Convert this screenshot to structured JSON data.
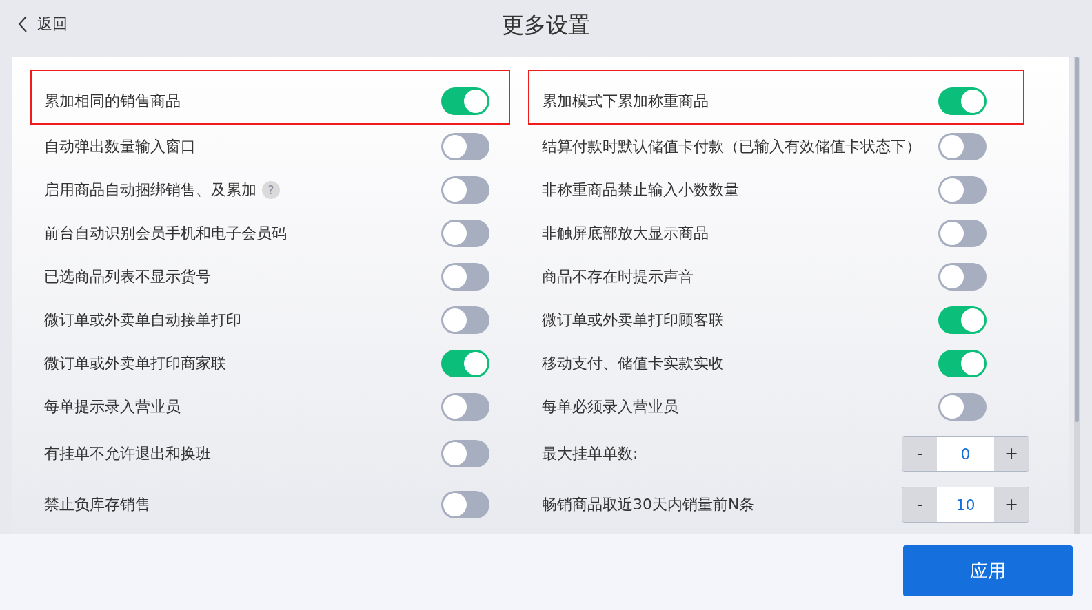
{
  "header": {
    "back": "返回",
    "title": "更多设置"
  },
  "rows": [
    {
      "left": {
        "kind": "toggle",
        "label": "累加相同的销售商品",
        "on": true,
        "highlighted": true
      },
      "right": {
        "kind": "toggle",
        "label": "累加模式下累加称重商品",
        "on": true,
        "highlighted": true
      }
    },
    {
      "left": {
        "kind": "toggle",
        "label": "自动弹出数量输入窗口",
        "on": false,
        "highlighted": false
      },
      "right": {
        "kind": "toggle",
        "label": "结算付款时默认储值卡付款（已输入有效储值卡状态下）",
        "on": false,
        "highlighted": false
      }
    },
    {
      "left": {
        "kind": "toggle",
        "label": "启用商品自动捆绑销售、及累加",
        "help": "?",
        "on": false,
        "highlighted": false
      },
      "right": {
        "kind": "toggle",
        "label": "非称重商品禁止输入小数数量",
        "on": false,
        "highlighted": false
      }
    },
    {
      "left": {
        "kind": "toggle",
        "label": "前台自动识别会员手机和电子会员码",
        "on": false,
        "highlighted": false
      },
      "right": {
        "kind": "toggle",
        "label": "非触屏底部放大显示商品",
        "on": false,
        "highlighted": false
      }
    },
    {
      "left": {
        "kind": "toggle",
        "label": "已选商品列表不显示货号",
        "on": false,
        "highlighted": false
      },
      "right": {
        "kind": "toggle",
        "label": "商品不存在时提示声音",
        "on": false,
        "highlighted": false
      }
    },
    {
      "left": {
        "kind": "toggle",
        "label": "微订单或外卖单自动接单打印",
        "on": false,
        "highlighted": false
      },
      "right": {
        "kind": "toggle",
        "label": "微订单或外卖单打印顾客联",
        "on": true,
        "highlighted": false
      }
    },
    {
      "left": {
        "kind": "toggle",
        "label": "微订单或外卖单打印商家联",
        "on": true,
        "highlighted": false
      },
      "right": {
        "kind": "toggle",
        "label": "移动支付、储值卡实款实收",
        "on": true,
        "highlighted": false
      }
    },
    {
      "left": {
        "kind": "toggle",
        "label": "每单提示录入营业员",
        "on": false,
        "highlighted": false
      },
      "right": {
        "kind": "toggle",
        "label": "每单必须录入营业员",
        "on": false,
        "highlighted": false
      }
    },
    {
      "left": {
        "kind": "toggle",
        "label": "有挂单不允许退出和换班",
        "on": false,
        "highlighted": false
      },
      "right": {
        "kind": "stepper",
        "label": "最大挂单单数:",
        "minus": "-",
        "value": "0",
        "plus": "+",
        "highlighted": false
      }
    },
    {
      "left": {
        "kind": "toggle",
        "label": "禁止负库存销售",
        "on": false,
        "highlighted": false
      },
      "right": {
        "kind": "stepper",
        "label": "畅销商品取近30天内销量前N条",
        "minus": "-",
        "value": "10",
        "plus": "+",
        "highlighted": false
      }
    }
  ],
  "footer": {
    "apply": "应用"
  }
}
